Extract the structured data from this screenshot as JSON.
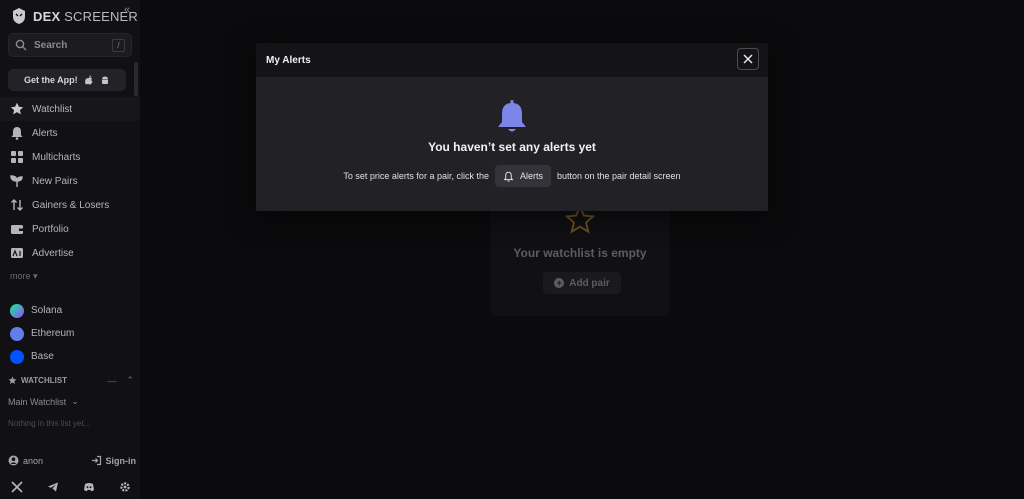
{
  "app": {
    "logo_primary": "DEX",
    "logo_secondary": "SCREENER"
  },
  "sidebar": {
    "search_placeholder": "Search",
    "search_shortcut": "/",
    "get_app_label": "Get the App!",
    "nav": [
      {
        "label": "Watchlist",
        "icon": "star-icon"
      },
      {
        "label": "Alerts",
        "icon": "bell-icon"
      },
      {
        "label": "Multicharts",
        "icon": "grid-icon"
      },
      {
        "label": "New Pairs",
        "icon": "sprout-icon"
      },
      {
        "label": "Gainers & Losers",
        "icon": "arrows-updown-icon"
      },
      {
        "label": "Portfolio",
        "icon": "wallet-icon"
      },
      {
        "label": "Advertise",
        "icon": "ad-icon"
      }
    ],
    "more_label": "more",
    "chains": [
      {
        "label": "Solana",
        "color": "#9945ff"
      },
      {
        "label": "Ethereum",
        "color": "#627eea"
      },
      {
        "label": "Base",
        "color": "#0052ff"
      }
    ],
    "watchlist_title": "WATCHLIST",
    "watchlist_select": "Main Watchlist",
    "watchlist_empty": "Nothing in this list yet...",
    "user_name": "anon",
    "signin_label": "Sign-in"
  },
  "main": {
    "empty_message": "Your watchlist is empty",
    "add_pair_label": "Add pair"
  },
  "modal": {
    "title": "My Alerts",
    "heading": "You haven’t set any alerts yet",
    "text_before": "To set price alerts for a pair, click the",
    "chip_label": "Alerts",
    "text_after": "button on the pair detail screen"
  },
  "colors": {
    "bell": "#7d86e8",
    "star_outline": "#6b5320"
  }
}
